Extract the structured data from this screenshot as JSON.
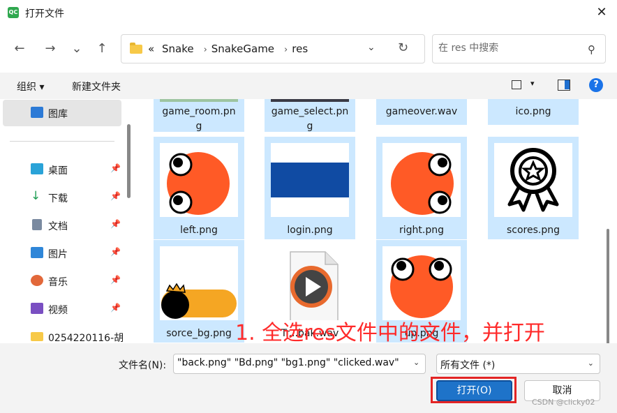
{
  "window": {
    "app_icon": "QC",
    "title": "打开文件",
    "close_icon": "✕"
  },
  "nav": {
    "back_icon": "←",
    "forward_icon": "→",
    "recent_icon": "⌄",
    "up_icon": "↑",
    "address": {
      "overflow": "«",
      "crumbs": [
        "Snake",
        "SnakeGame",
        "res"
      ],
      "separator": "›",
      "dropdown_icon": "⌄",
      "refresh_icon": "↻"
    },
    "search": {
      "placeholder": "在 res 中搜索",
      "icon": "⚲"
    }
  },
  "toolbar": {
    "organize_label": "组织 ▾",
    "new_folder_label": "新建文件夹",
    "view_dropdown": "▾",
    "help": "?"
  },
  "sidebar": {
    "items": [
      {
        "label": "图库",
        "icon": "gallery-icon",
        "color": "#2c7ad6",
        "pinned": false
      },
      {
        "label": "桌面",
        "icon": "desktop-icon",
        "color": "#2aa3d8",
        "pinned": true
      },
      {
        "label": "下载",
        "icon": "download-icon",
        "color": "#1f9e54",
        "pinned": true
      },
      {
        "label": "文档",
        "icon": "documents-icon",
        "color": "#7a8aa0",
        "pinned": true
      },
      {
        "label": "图片",
        "icon": "pictures-icon",
        "color": "#2f86d8",
        "pinned": true
      },
      {
        "label": "音乐",
        "icon": "music-icon",
        "color": "#e2683a",
        "pinned": true
      },
      {
        "label": "视频",
        "icon": "videos-icon",
        "color": "#7a4fc2",
        "pinned": true
      },
      {
        "label": "0254220116-胡",
        "icon": "folder-icon",
        "color": "#f7c948",
        "pinned": false
      }
    ],
    "pin_icon": "📌"
  },
  "files": {
    "top_row": [
      {
        "name": "game_room.pn",
        "name2": "g"
      },
      {
        "name": "game_select.pn",
        "name2": "g"
      },
      {
        "name": "gameover.wav",
        "name2": ""
      },
      {
        "name": "ico.png",
        "name2": ""
      }
    ],
    "tiles": [
      {
        "name": "left.png",
        "thumb": "snake-left"
      },
      {
        "name": "login.png",
        "thumb": "login-bg"
      },
      {
        "name": "right.png",
        "thumb": "snake-right"
      },
      {
        "name": "scores.png",
        "thumb": "award"
      },
      {
        "name": "sorce_bg.png",
        "thumb": "score-bar"
      },
      {
        "name": "Tr...bak.wav",
        "thumb": "audio"
      },
      {
        "name": "up.png",
        "thumb": "snake-up"
      }
    ]
  },
  "annotation": "1. 全选res文件中的文件，并打开",
  "footer": {
    "filename_label": "文件名(N):",
    "filename_value": "\"back.png\" \"Bd.png\" \"bg1.png\" \"clicked.wav\"",
    "filetype_value": "所有文件 (*)",
    "open_label": "打开(O)",
    "cancel_label": "取消",
    "watermark": "CSDN @clicky02"
  },
  "colors": {
    "selection": "#cce8ff",
    "snake": "#ff5a26",
    "accent": "#1e73c9",
    "highlight": "#e32424"
  }
}
